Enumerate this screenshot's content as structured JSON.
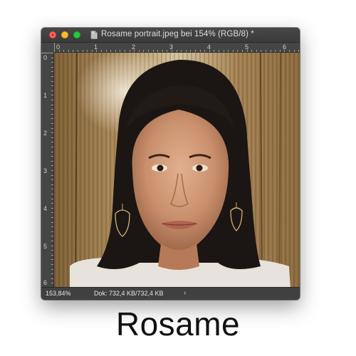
{
  "window": {
    "title": "Rosame portrait.jpeg bei 154% (RGB/8) *",
    "controls": [
      "close",
      "minimize",
      "zoom"
    ]
  },
  "ruler": {
    "horizontal": [
      "0",
      "1",
      "2",
      "3",
      "4",
      "5",
      "6"
    ],
    "vertical": [
      "0",
      "1",
      "2",
      "3",
      "4",
      "5",
      "6"
    ]
  },
  "canvas": {
    "image_description": "portrait photo"
  },
  "statusbar": {
    "zoom": "153,84%",
    "doc_info": "Dok: 732,4 KB/732,4 KB",
    "arrow": "›"
  },
  "caption": "Rosame",
  "colors": {
    "close": "#fc5f57",
    "minimize": "#fdbc2e",
    "zoom": "#28c840",
    "chrome": "#3a3a3a"
  }
}
